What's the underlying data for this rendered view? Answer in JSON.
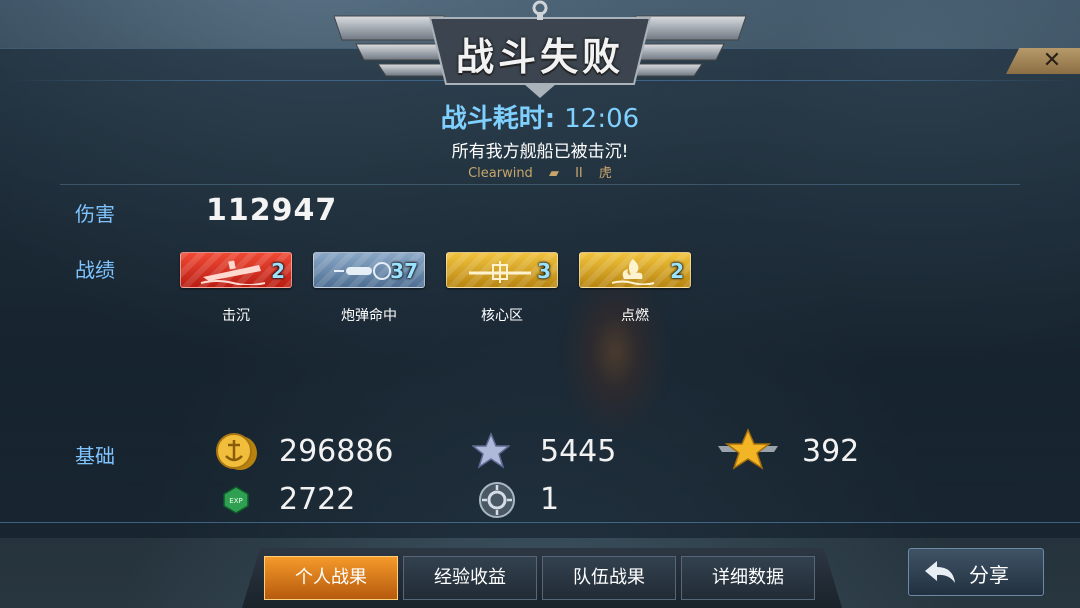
{
  "header": {
    "title": "战斗失败",
    "close_label": "✕",
    "duration_label": "战斗耗时:",
    "duration_value": "12:06",
    "message": "所有我方舰船已被击沉!",
    "player_name": "Clearwind",
    "ship_tier": "II",
    "ship_name": "虎"
  },
  "damage": {
    "label": "伤害",
    "value": "112947"
  },
  "achievements": {
    "label": "战绩",
    "items": [
      {
        "label": "击沉",
        "count": "2"
      },
      {
        "label": "炮弹命中",
        "count": "37"
      },
      {
        "label": "核心区",
        "count": "3"
      },
      {
        "label": "点燃",
        "count": "2"
      }
    ]
  },
  "base": {
    "label": "基础",
    "credits": "296886",
    "star_points": "5445",
    "gold_star_points": "392",
    "exp": "2722",
    "free_exp": "1"
  },
  "tabs": [
    {
      "label": "个人战果"
    },
    {
      "label": "经验收益"
    },
    {
      "label": "队伍战果"
    },
    {
      "label": "详细数据"
    }
  ],
  "share": {
    "label": "分享"
  },
  "icons": {
    "coin": "anchor-coin-icon",
    "exp": "exp-hexagon-icon",
    "silver_star": "silver-star-icon",
    "gold_star": "winged-gold-star-icon",
    "free_exp": "gear-circle-icon",
    "share": "share-arrow-icon"
  },
  "colors": {
    "accent_blue": "#7fc4ff",
    "active_tab": "#f59a2a",
    "medal_red": "#d9301f",
    "medal_blue": "#6e8db0",
    "medal_gold": "#e0a826"
  }
}
